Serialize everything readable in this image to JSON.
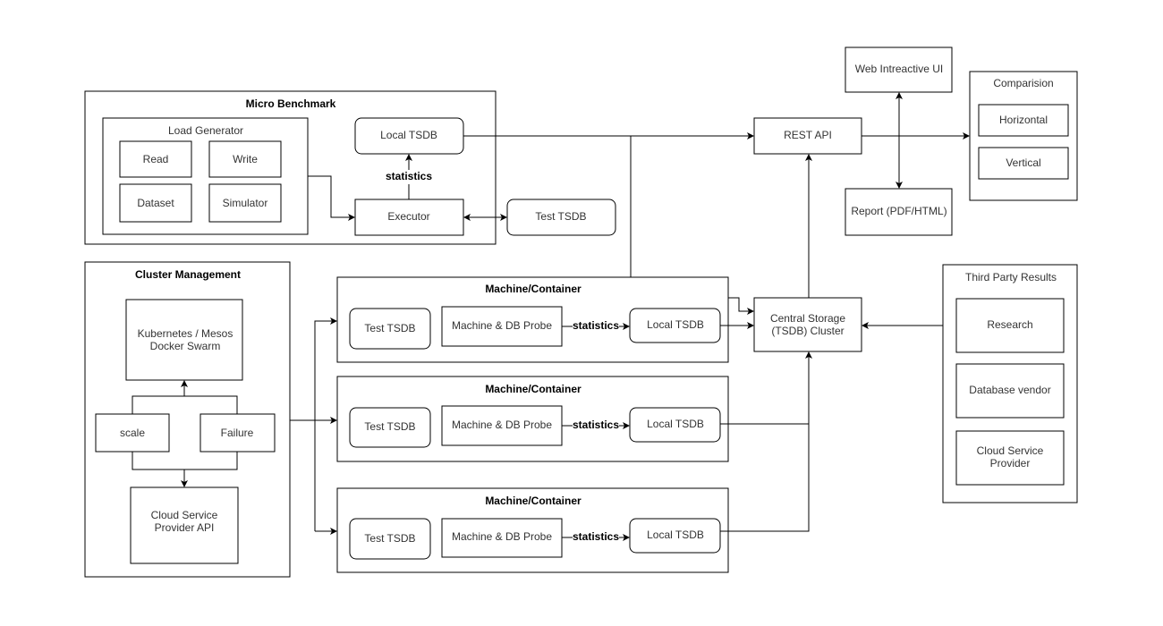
{
  "micro_benchmark": {
    "title": "Micro Benchmark",
    "load_generator": {
      "title": "Load Generator",
      "items": [
        "Read",
        "Write",
        "Dataset",
        "Simulator"
      ]
    },
    "local_tsdb": "Local TSDB",
    "statistics": "statistics",
    "executor": "Executor",
    "test_tsdb": "Test TSDB"
  },
  "rest_api": "REST API",
  "web_ui": "Web Intreactive UI",
  "report": "Report (PDF/HTML)",
  "comparision": {
    "title": "Comparision",
    "items": [
      "Horizontal",
      "Vertical"
    ]
  },
  "central_storage": {
    "line1": "Central Storage",
    "line2": "(TSDB) Cluster"
  },
  "third_party": {
    "title": "Third Party Results",
    "items": [
      "Research",
      "Database vendor"
    ],
    "cloud_line1": "Cloud Service",
    "cloud_line2": "Provider"
  },
  "cluster_management": {
    "title": "Cluster Management",
    "orchestrator_line1": "Kubernetes / Mesos",
    "orchestrator_line2": "Docker Swarm",
    "scale": "scale",
    "failure": "Failure",
    "cloud_api_line1": "Cloud Service",
    "cloud_api_line2": "Provider API"
  },
  "machines": [
    {
      "title": "Machine/Container",
      "test_tsdb": "Test TSDB",
      "probe": "Machine & DB Probe",
      "statistics": "statistics",
      "local_tsdb": "Local TSDB"
    },
    {
      "title": "Machine/Container",
      "test_tsdb": "Test TSDB",
      "probe": "Machine & DB Probe",
      "statistics": "statistics",
      "local_tsdb": "Local TSDB"
    },
    {
      "title": "Machine/Container",
      "test_tsdb": "Test TSDB",
      "probe": "Machine & DB Probe",
      "statistics": "statistics",
      "local_tsdb": "Local TSDB"
    }
  ]
}
